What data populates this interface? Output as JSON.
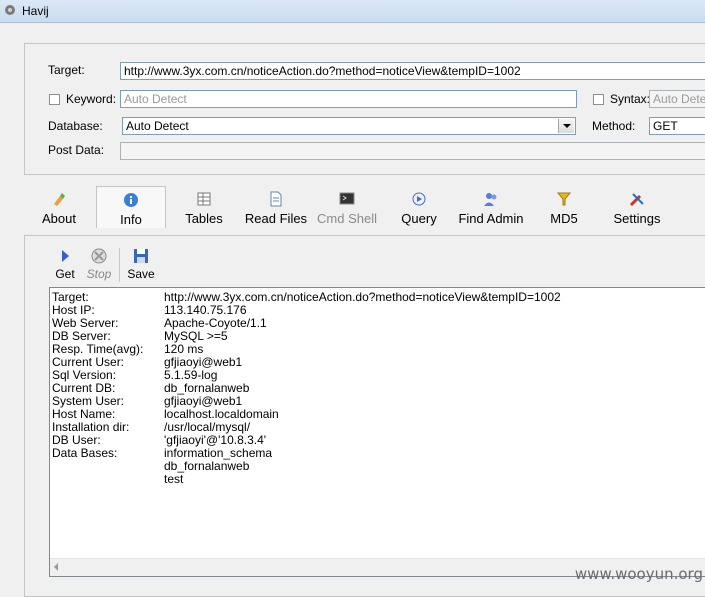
{
  "window": {
    "title": "Havij"
  },
  "params": {
    "target_label": "Target:",
    "target_value": "http://www.3yx.com.cn/noticeAction.do?method=noticeView&tempID=1002",
    "keyword_label": "Keyword:",
    "keyword_placeholder": "Auto Detect",
    "syntax_label": "Syntax:",
    "syntax_placeholder": "Auto Dete",
    "database_label": "Database:",
    "database_value": "Auto Detect",
    "method_label": "Method:",
    "method_value": "GET",
    "postdata_label": "Post Data:"
  },
  "tabs": [
    {
      "label": "About",
      "icon": "about-icon"
    },
    {
      "label": "Info",
      "icon": "info-icon"
    },
    {
      "label": "Tables",
      "icon": "tables-icon"
    },
    {
      "label": "Read Files",
      "icon": "read-files-icon"
    },
    {
      "label": "Cmd Shell",
      "icon": "cmd-shell-icon"
    },
    {
      "label": "Query",
      "icon": "query-icon"
    },
    {
      "label": "Find Admin",
      "icon": "find-admin-icon"
    },
    {
      "label": "MD5",
      "icon": "md5-icon"
    },
    {
      "label": "Settings",
      "icon": "settings-icon"
    }
  ],
  "toolbar": {
    "get_label": "Get",
    "stop_label": "Stop",
    "save_label": "Save"
  },
  "info": [
    {
      "key": "Target:",
      "value": "http://www.3yx.com.cn/noticeAction.do?method=noticeView&tempID=1002"
    },
    {
      "key": "Host IP:",
      "value": "113.140.75.176"
    },
    {
      "key": "Web Server:",
      "value": "Apache-Coyote/1.1"
    },
    {
      "key": "DB Server:",
      "value": "MySQL >=5"
    },
    {
      "key": "Resp. Time(avg):",
      "value": "120 ms"
    },
    {
      "key": "Current User:",
      "value": "gfjiaoyi@web1"
    },
    {
      "key": "Sql Version:",
      "value": "5.1.59-log"
    },
    {
      "key": "Current DB:",
      "value": "db_fornalanweb"
    },
    {
      "key": "System User:",
      "value": "gfjiaoyi@web1"
    },
    {
      "key": "Host Name:",
      "value": "localhost.localdomain"
    },
    {
      "key": "Installation dir:",
      "value": "/usr/local/mysql/"
    },
    {
      "key": "DB User:",
      "value": "'gfjiaoyi'@'10.8.3.4'"
    },
    {
      "key": "Data Bases:",
      "value": "information_schema"
    },
    {
      "key": "",
      "value": "db_fornalanweb"
    },
    {
      "key": "",
      "value": "test"
    }
  ],
  "watermark": "www.wooyun.org"
}
